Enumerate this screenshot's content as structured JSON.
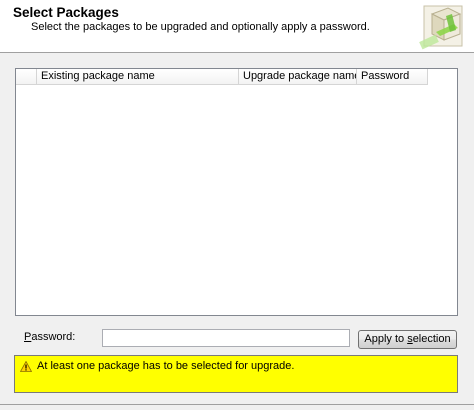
{
  "header": {
    "title": "Select Packages",
    "subtitle": "Select the packages to be upgraded and optionally apply a password.",
    "icon": "package-upgrade-icon"
  },
  "package_list": {
    "columns": [
      {
        "key": "select",
        "label": ""
      },
      {
        "key": "existing",
        "label": "Existing package name"
      },
      {
        "key": "upgrade",
        "label": "Upgrade package name"
      },
      {
        "key": "password",
        "label": "Password"
      }
    ],
    "rows": []
  },
  "password": {
    "label_accesskey": "P",
    "label_rest": "assword:",
    "value": "",
    "placeholder": ""
  },
  "apply_button": {
    "label_before": "Apply to ",
    "label_accesskey": "s",
    "label_after": "election"
  },
  "warning": {
    "icon": "warning-icon",
    "message": "At least one package has to be selected for upgrade."
  },
  "colors": {
    "warning_background": "#ffff00",
    "header_background": "#ffffff",
    "dialog_background": "#f0f0f0"
  }
}
